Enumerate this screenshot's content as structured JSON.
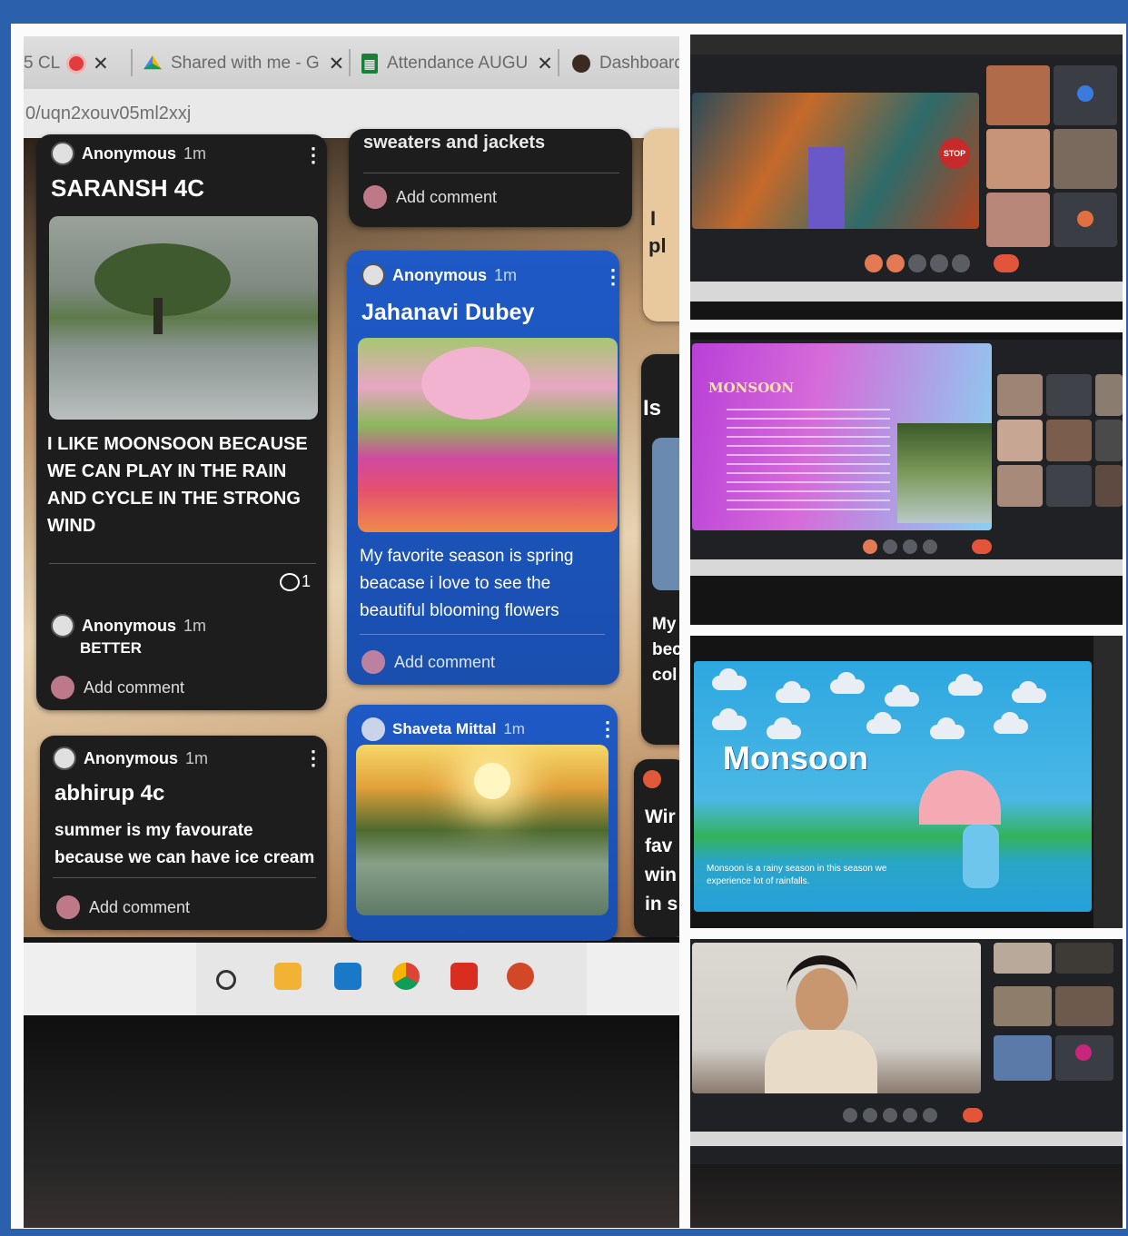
{
  "browser": {
    "tabs": [
      {
        "label": "5 CL",
        "icon": "record-icon"
      },
      {
        "label": "Shared with me - G",
        "icon": "drive-icon"
      },
      {
        "label": "Attendance AUGU",
        "icon": "sheets-icon"
      },
      {
        "label": "Dashboard",
        "icon": "avatar-icon"
      }
    ],
    "url": "0/uqn2xouv05ml2xxj"
  },
  "padlet": {
    "post1": {
      "author": "Anonymous",
      "time": "1m",
      "title": "SARANSH 4C",
      "body": "I LIKE MOONSOON BECAUSE WE CAN PLAY IN THE RAIN AND CYCLE IN THE STRONG WIND",
      "comment_count": "1",
      "comment_author": "Anonymous",
      "comment_time": "1m",
      "comment_text": "BETTER",
      "add_comment": "Add comment"
    },
    "post2": {
      "author": "Anonymous",
      "time": "1m",
      "title": "abhirup 4c",
      "body": "summer is my favourate because we can have ice cream",
      "add_comment": "Add comment"
    },
    "post3": {
      "partial_title": "sweaters and jackets",
      "add_comment": "Add comment"
    },
    "post4": {
      "author": "Anonymous",
      "time": "1m",
      "title": "Jahanavi Dubey",
      "body": "My favorite season is spring beacase i love to see the beautiful blooming flowers",
      "add_comment": "Add comment"
    },
    "post5": {
      "author": "Shaveta Mittal",
      "time": "1m"
    },
    "partial_column": {
      "a": "I",
      "b": "pl",
      "c": "Is",
      "d": "My",
      "e": "bec",
      "f": "col",
      "g": "Wir",
      "h": "fav",
      "i": "win",
      "j": "in s"
    }
  },
  "meet": {
    "slide2_title": "MONSOON",
    "slide3_title": "Monsoon",
    "slide3_caption": "Monsoon is a rainy season in this season we experience lot of rainfalls.",
    "stop_sign": "STOP"
  },
  "colors": {
    "frame": "#2b61ac",
    "padlet_blue": "#1e59c6",
    "card_dark": "#1d1d1d",
    "end_call": "#e2553b"
  }
}
